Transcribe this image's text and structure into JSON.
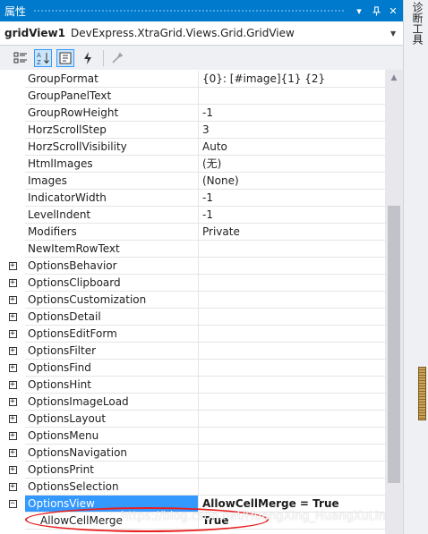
{
  "panel": {
    "title": "属性",
    "title_bar_buttons": [
      "dropdown-icon",
      "pin-icon",
      "close-icon"
    ],
    "accent": "#007acc"
  },
  "object_selector": {
    "name": "gridView1",
    "type": "DevExpress.XtraGrid.Views.Grid.GridView"
  },
  "toolbar": {
    "buttons": [
      "categorized-icon",
      "alphabetical-icon",
      "properties-icon",
      "events-icon",
      "property-pages-icon"
    ],
    "active": [
      "alphabetical-icon",
      "properties-icon"
    ]
  },
  "properties": [
    {
      "name": "GroupFormat",
      "value": "{0}: [#image]{1} {2}"
    },
    {
      "name": "GroupPanelText",
      "value": ""
    },
    {
      "name": "GroupRowHeight",
      "value": "-1"
    },
    {
      "name": "HorzScrollStep",
      "value": "3"
    },
    {
      "name": "HorzScrollVisibility",
      "value": "Auto"
    },
    {
      "name": "HtmlImages",
      "value": "(无)"
    },
    {
      "name": "Images",
      "value": "(None)"
    },
    {
      "name": "IndicatorWidth",
      "value": "-1"
    },
    {
      "name": "LevelIndent",
      "value": "-1"
    },
    {
      "name": "Modifiers",
      "value": "Private"
    },
    {
      "name": "NewItemRowText",
      "value": ""
    },
    {
      "name": "OptionsBehavior",
      "value": "",
      "expander": "+"
    },
    {
      "name": "OptionsClipboard",
      "value": "",
      "expander": "+"
    },
    {
      "name": "OptionsCustomization",
      "value": "",
      "expander": "+"
    },
    {
      "name": "OptionsDetail",
      "value": "",
      "expander": "+"
    },
    {
      "name": "OptionsEditForm",
      "value": "",
      "expander": "+"
    },
    {
      "name": "OptionsFilter",
      "value": "",
      "expander": "+"
    },
    {
      "name": "OptionsFind",
      "value": "",
      "expander": "+"
    },
    {
      "name": "OptionsHint",
      "value": "",
      "expander": "+"
    },
    {
      "name": "OptionsImageLoad",
      "value": "",
      "expander": "+"
    },
    {
      "name": "OptionsLayout",
      "value": "",
      "expander": "+"
    },
    {
      "name": "OptionsMenu",
      "value": "",
      "expander": "+"
    },
    {
      "name": "OptionsNavigation",
      "value": "",
      "expander": "+"
    },
    {
      "name": "OptionsPrint",
      "value": "",
      "expander": "+"
    },
    {
      "name": "OptionsSelection",
      "value": "",
      "expander": "+"
    },
    {
      "name": "OptionsView",
      "value": "AllowCellMerge = True",
      "expander": "−",
      "selected": true
    },
    {
      "name": "AllowCellMerge",
      "value": "True",
      "child": true
    }
  ],
  "side_tab": {
    "label": "诊断工具"
  },
  "watermark": "https://blog.csdn.net/HuangXing_HuangXuLin",
  "colors": {
    "selection": "#3399ff",
    "highlight_ellipse": "#e81f1f"
  }
}
